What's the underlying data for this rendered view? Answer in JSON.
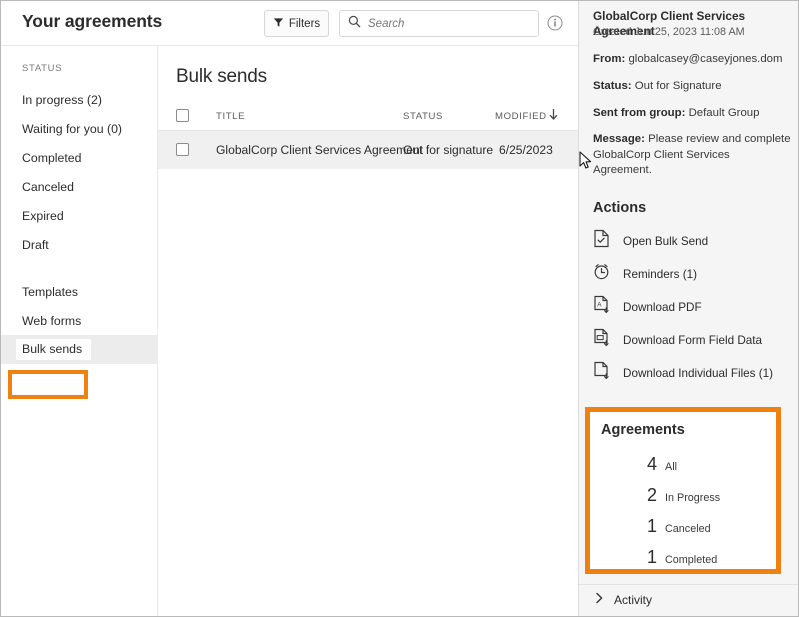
{
  "header": {
    "title": "Your agreements",
    "filters_label": "Filters",
    "filter_icon": "funnel-icon",
    "search_placeholder": "Search",
    "search_value": "",
    "search_icon": "search-icon",
    "info_icon": "info-circle-icon"
  },
  "sidebar": {
    "group_label": "STATUS",
    "items": [
      {
        "label": "In progress (2)",
        "selected": false
      },
      {
        "label": "Waiting for you (0)",
        "selected": false
      },
      {
        "label": "Completed",
        "selected": false
      },
      {
        "label": "Canceled",
        "selected": false
      },
      {
        "label": "Expired",
        "selected": false
      },
      {
        "label": "Draft",
        "selected": false
      }
    ],
    "items2": [
      {
        "label": "Templates",
        "selected": false
      },
      {
        "label": "Web forms",
        "selected": false
      },
      {
        "label": "Bulk sends",
        "selected": true
      }
    ],
    "highlight_color": "#f08010"
  },
  "main": {
    "title": "Bulk sends",
    "columns": {
      "title": "TITLE",
      "status": "STATUS",
      "modified": "MODIFIED"
    },
    "sort_icon": "arrow-down-icon",
    "rows": [
      {
        "title": "GlobalCorp Client Services Agreement",
        "status": "Out for signature",
        "modified": "6/25/2023"
      }
    ]
  },
  "details": {
    "title": "GlobalCorp Client Services Agreement",
    "created": "Created Jun 25, 2023 11:08 AM",
    "from_label": "From:",
    "from_value": "globalcasey@caseyjones.dom",
    "status_label": "Status:",
    "status_value": "Out for Signature",
    "group_label": "Sent from group:",
    "group_value": "Default Group",
    "message_label": "Message:",
    "message_value": "Please review and complete GlobalCorp Client Services Agreement."
  },
  "actions": {
    "heading": "Actions",
    "items": [
      {
        "label": "Open Bulk Send",
        "icon": "document-check-icon"
      },
      {
        "label": "Reminders (1)",
        "icon": "alarm-clock-icon"
      },
      {
        "label": "Download PDF",
        "icon": "pdf-download-icon"
      },
      {
        "label": "Download Form Field Data",
        "icon": "form-data-download-icon"
      },
      {
        "label": "Download Individual Files (1)",
        "icon": "file-download-icon"
      }
    ]
  },
  "agreements": {
    "heading": "Agreements",
    "stats": [
      {
        "count": "4",
        "label": "All"
      },
      {
        "count": "2",
        "label": "In Progress"
      },
      {
        "count": "1",
        "label": "Canceled"
      },
      {
        "count": "1",
        "label": "Completed"
      }
    ],
    "highlight_color": "#f08010"
  },
  "activity": {
    "label": "Activity",
    "icon": "chevron-right-icon"
  }
}
